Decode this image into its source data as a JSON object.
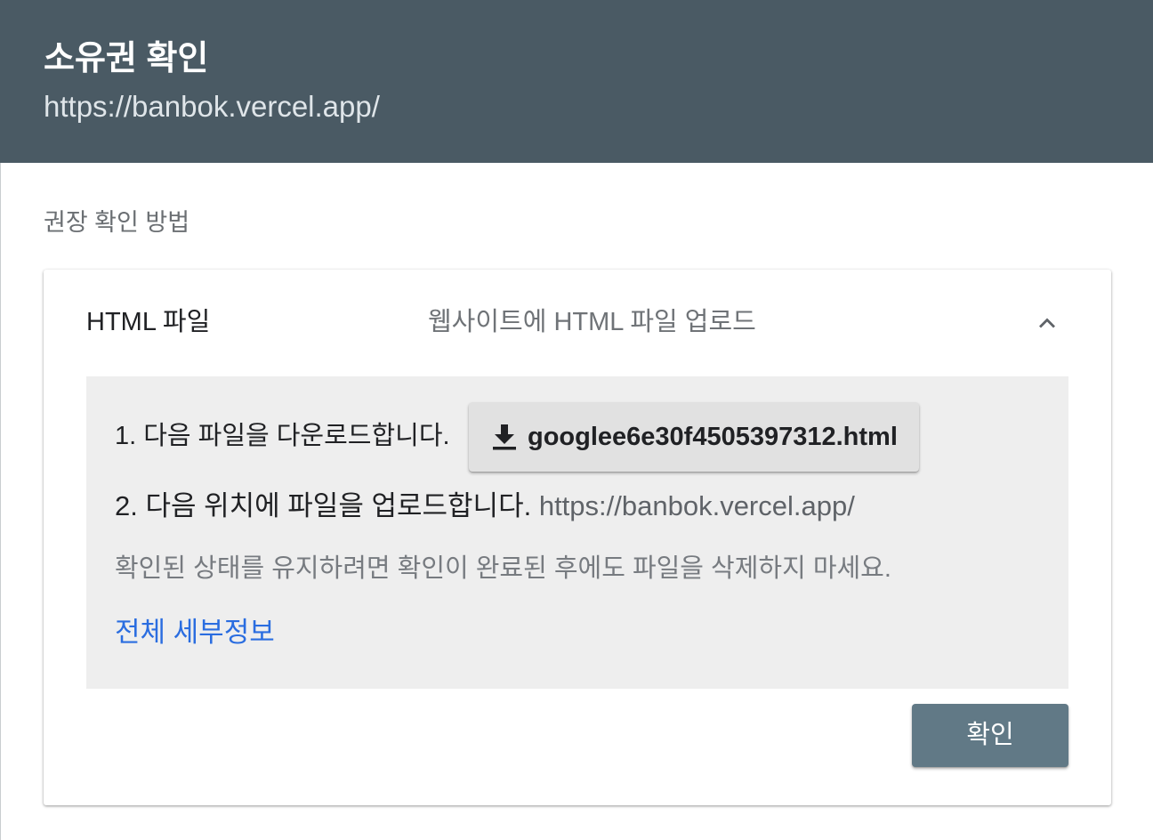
{
  "header": {
    "title": "소유권 확인",
    "url": "https://banbok.vercel.app/"
  },
  "section_label": "권장 확인 방법",
  "method": {
    "name": "HTML 파일",
    "description": "웹사이트에 HTML 파일 업로드",
    "collapse_icon": "chevron-up-icon",
    "step1_label": "1. 다음 파일을 다운로드합니다.",
    "download_icon": "download-icon",
    "download_filename": "googlee6e30f4505397312.html",
    "step2_label": "2. 다음 위치에 파일을 업로드합니다.",
    "step2_url": "https://banbok.vercel.app/",
    "note": "확인된 상태를 유지하려면 확인이 완료된 후에도 파일을 삭제하지 마세요.",
    "details_link": "전체 세부정보"
  },
  "confirm_button": "확인",
  "colors": {
    "header_bg": "#4a5a64",
    "panel_bg": "#eeeeee",
    "link": "#2a6de0",
    "confirm_bg": "#617986"
  }
}
